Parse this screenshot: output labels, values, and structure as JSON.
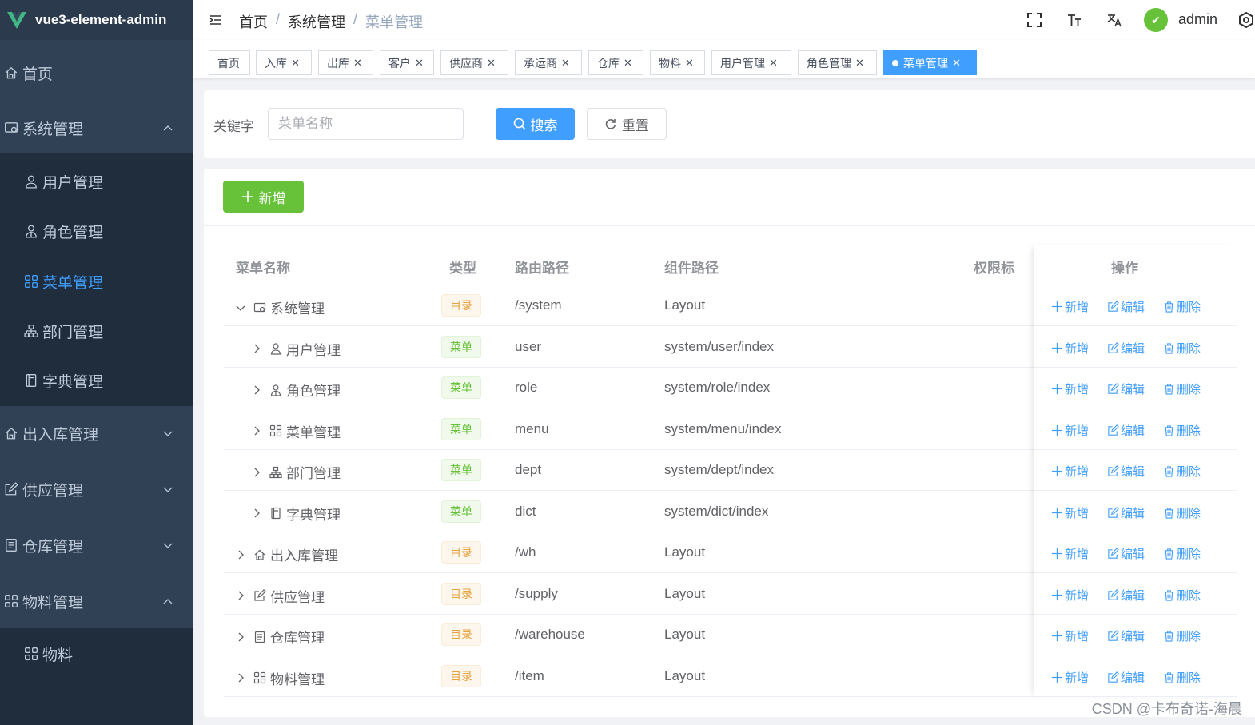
{
  "app": {
    "title": "vue3-element-admin"
  },
  "sidebar": {
    "items": [
      {
        "label": "首页",
        "icon": "home-icon",
        "type": "top"
      },
      {
        "label": "系统管理",
        "icon": "system-icon",
        "type": "top",
        "expanded": true
      },
      {
        "label": "用户管理",
        "icon": "user-icon",
        "type": "sub"
      },
      {
        "label": "角色管理",
        "icon": "role-icon",
        "type": "sub"
      },
      {
        "label": "菜单管理",
        "icon": "menu-icon",
        "type": "sub",
        "active": true
      },
      {
        "label": "部门管理",
        "icon": "dept-icon",
        "type": "sub"
      },
      {
        "label": "字典管理",
        "icon": "dict-icon",
        "type": "sub"
      },
      {
        "label": "出入库管理",
        "icon": "home-icon",
        "type": "top",
        "expanded": false
      },
      {
        "label": "供应管理",
        "icon": "edit-icon",
        "type": "top",
        "expanded": false
      },
      {
        "label": "仓库管理",
        "icon": "document-icon",
        "type": "top",
        "expanded": false
      },
      {
        "label": "物料管理",
        "icon": "menu-icon",
        "type": "top",
        "expanded": true
      },
      {
        "label": "物料",
        "icon": "menu-icon",
        "type": "sub"
      }
    ]
  },
  "header": {
    "breadcrumb": [
      "首页",
      "系统管理",
      "菜单管理"
    ],
    "username": "admin"
  },
  "tags": [
    {
      "label": "首页",
      "closable": false
    },
    {
      "label": "入库",
      "closable": true
    },
    {
      "label": "出库",
      "closable": true
    },
    {
      "label": "客户",
      "closable": true
    },
    {
      "label": "供应商",
      "closable": true
    },
    {
      "label": "承运商",
      "closable": true
    },
    {
      "label": "仓库",
      "closable": true
    },
    {
      "label": "物料",
      "closable": true
    },
    {
      "label": "用户管理",
      "closable": true
    },
    {
      "label": "角色管理",
      "closable": true
    },
    {
      "label": "菜单管理",
      "closable": true,
      "active": true
    }
  ],
  "search": {
    "label": "关键字",
    "placeholder": "菜单名称",
    "search_label": "搜索",
    "reset_label": "重置"
  },
  "toolbar": {
    "add_label": "新增"
  },
  "table": {
    "columns": [
      "菜单名称",
      "类型",
      "路由路径",
      "组件路径",
      "权限标",
      "操作"
    ],
    "rows": [
      {
        "name": "系统管理",
        "icon": "system-icon",
        "level": 0,
        "expand": "down",
        "type": "目录",
        "kind": "dir",
        "path": "/system",
        "component": "Layout"
      },
      {
        "name": "用户管理",
        "icon": "user-icon",
        "level": 1,
        "expand": "right",
        "type": "菜单",
        "kind": "menu",
        "path": "user",
        "component": "system/user/index"
      },
      {
        "name": "角色管理",
        "icon": "role-icon",
        "level": 1,
        "expand": "right",
        "type": "菜单",
        "kind": "menu",
        "path": "role",
        "component": "system/role/index"
      },
      {
        "name": "菜单管理",
        "icon": "menu-icon",
        "level": 1,
        "expand": "right",
        "type": "菜单",
        "kind": "menu",
        "path": "menu",
        "component": "system/menu/index"
      },
      {
        "name": "部门管理",
        "icon": "dept-icon",
        "level": 1,
        "expand": "right",
        "type": "菜单",
        "kind": "menu",
        "path": "dept",
        "component": "system/dept/index"
      },
      {
        "name": "字典管理",
        "icon": "dict-icon",
        "level": 1,
        "expand": "right",
        "type": "菜单",
        "kind": "menu",
        "path": "dict",
        "component": "system/dict/index"
      },
      {
        "name": "出入库管理",
        "icon": "home-icon",
        "level": 0,
        "expand": "right",
        "type": "目录",
        "kind": "dir",
        "path": "/wh",
        "component": "Layout"
      },
      {
        "name": "供应管理",
        "icon": "edit-icon",
        "level": 0,
        "expand": "right",
        "type": "目录",
        "kind": "dir",
        "path": "/supply",
        "component": "Layout"
      },
      {
        "name": "仓库管理",
        "icon": "document-icon",
        "level": 0,
        "expand": "right",
        "type": "目录",
        "kind": "dir",
        "path": "/warehouse",
        "component": "Layout"
      },
      {
        "name": "物料管理",
        "icon": "menu-icon",
        "level": 0,
        "expand": "right",
        "type": "目录",
        "kind": "dir",
        "path": "/item",
        "component": "Layout"
      }
    ],
    "ops": {
      "add": "新增",
      "edit": "编辑",
      "delete": "删除"
    }
  },
  "watermark": "CSDN @卡布奇诺-海晨",
  "colors": {
    "sidebar": "#304156",
    "primary": "#409eff",
    "success": "#67c23a",
    "warning": "#e6a23c"
  }
}
